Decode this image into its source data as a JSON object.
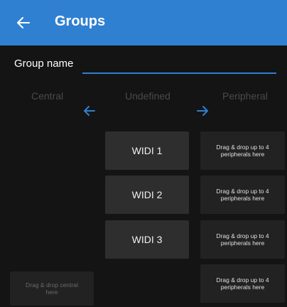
{
  "appbar": {
    "title": "Groups",
    "back_icon": "arrow-left-icon"
  },
  "form": {
    "name_label": "Group name",
    "name_value": "",
    "name_placeholder": ""
  },
  "columns": {
    "central": "Central",
    "undefined": "Undefined",
    "peripheral": "Peripheral"
  },
  "arrows": {
    "left_icon": "arrow-left-icon",
    "right_icon": "arrow-right-icon"
  },
  "devices": [
    {
      "label": "WIDI 1"
    },
    {
      "label": "WIDI 2"
    },
    {
      "label": "WIDI 3"
    }
  ],
  "peripheral_zones": [
    {
      "text": "Drag & drop up to 4 peripherals here"
    },
    {
      "text": "Drag & drop up to 4 peripherals here"
    },
    {
      "text": "Drag & drop up to 4 peripherals here"
    },
    {
      "text": "Drag & drop up to 4 peripherals here"
    }
  ],
  "central_zone": {
    "text": "Drag & drop central here"
  },
  "colors": {
    "accent": "#2f80d1",
    "background": "#141414",
    "card": "#2e2e2e",
    "zone": "#222222"
  }
}
